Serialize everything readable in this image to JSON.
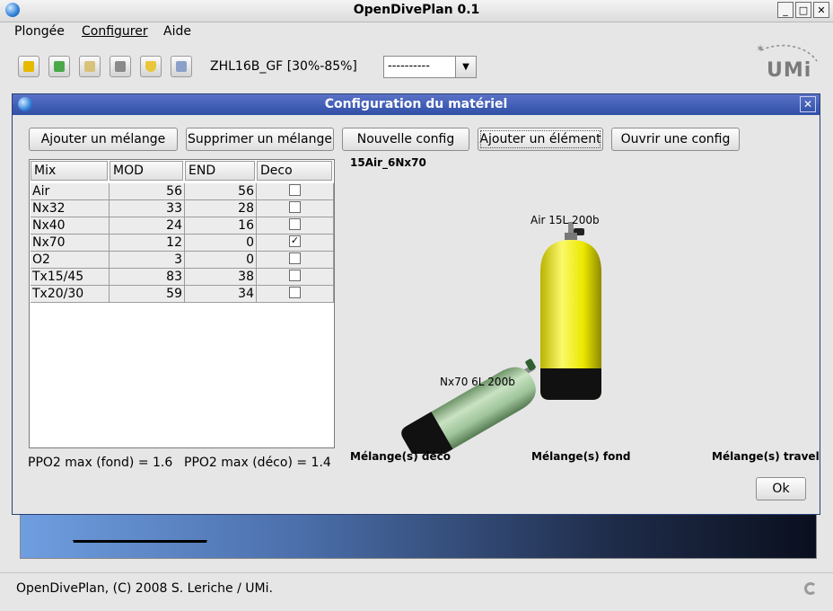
{
  "window": {
    "title": "OpenDivePlan 0.1",
    "min": "_",
    "max": "□",
    "close": "✕"
  },
  "menu": [
    "Plongée",
    "Configurer",
    "Aide"
  ],
  "toolbar": {
    "profile_label": "ZHL16B_GF [30%-85%]",
    "combo_value": "----------",
    "combo_arrow": "▼"
  },
  "logo": {
    "text": "UMi"
  },
  "statusbar": {
    "text": "OpenDivePlan, (C) 2008 S. Leriche / UMi."
  },
  "dialog": {
    "title": "Configuration du matériel",
    "close": "✕",
    "buttons": [
      "Ajouter un mélange",
      "Supprimer un mélange",
      "Nouvelle config",
      "Ajouter un élément",
      "Ouvrir une config"
    ],
    "table": {
      "headers": [
        "Mix",
        "MOD",
        "END",
        "Deco"
      ],
      "rows": [
        {
          "mix": "Air",
          "mod": "56",
          "end": "56",
          "deco": false
        },
        {
          "mix": "Nx32",
          "mod": "33",
          "end": "28",
          "deco": false
        },
        {
          "mix": "Nx40",
          "mod": "24",
          "end": "16",
          "deco": false
        },
        {
          "mix": "Nx70",
          "mod": "12",
          "end": "0",
          "deco": true
        },
        {
          "mix": "O2",
          "mod": "3",
          "end": "0",
          "deco": false
        },
        {
          "mix": "Tx15/45",
          "mod": "83",
          "end": "38",
          "deco": false
        },
        {
          "mix": "Tx20/30",
          "mod": "59",
          "end": "34",
          "deco": false
        }
      ]
    },
    "ppo2_fond": "PPO2 max (fond) = 1.6",
    "ppo2_deco": "PPO2 max (déco) = 1.4",
    "config_name": "15Air_6Nx70",
    "tanks": [
      {
        "label": "Air 15L 200b",
        "color": "#f2ef12"
      },
      {
        "label": "Nx70 6L 200b",
        "color": "#9fc49a"
      }
    ],
    "sections": [
      "Mélange(s) déco",
      "Mélange(s) fond",
      "Mélange(s) travel"
    ],
    "ok": "Ok"
  }
}
